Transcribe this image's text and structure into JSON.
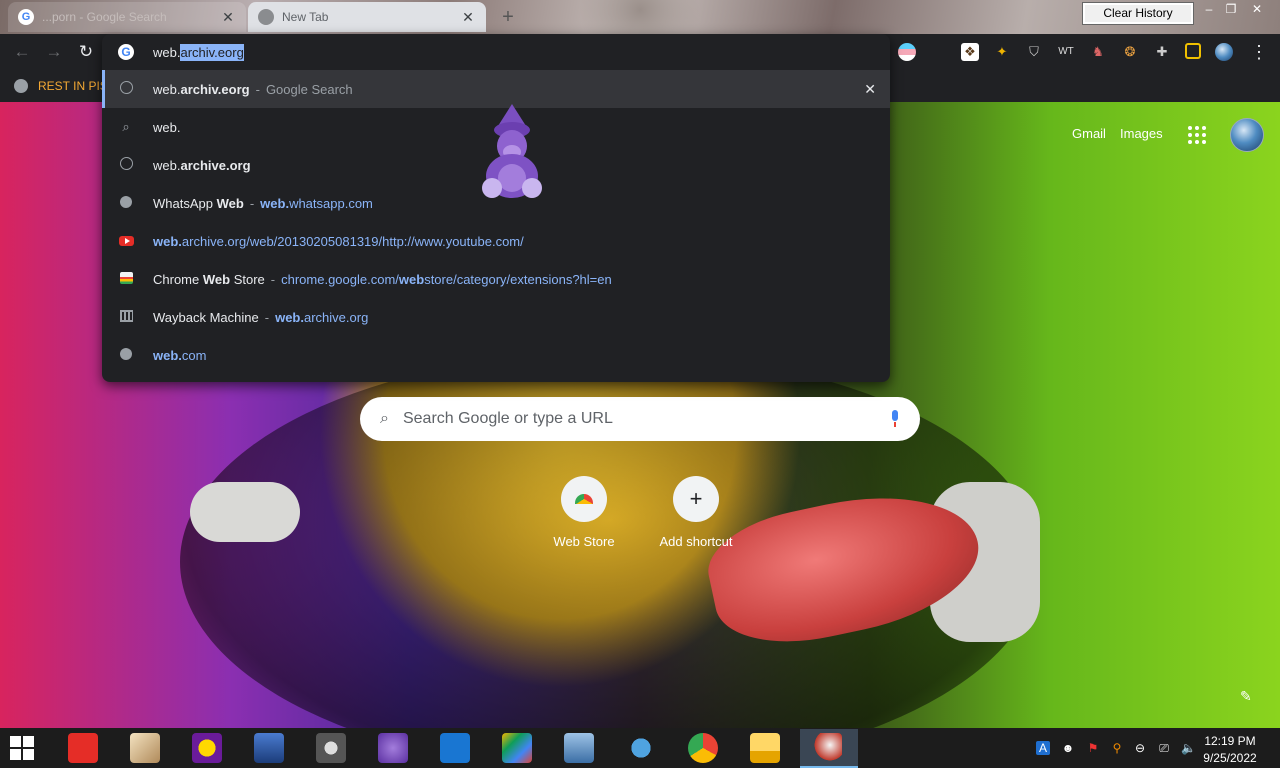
{
  "browser": {
    "tabs": [
      {
        "label": "...porn - Google Search",
        "active": false
      },
      {
        "label": "New Tab",
        "active": true
      }
    ],
    "clear_history_label": "Clear History",
    "window_controls": {
      "minimize": "–",
      "restore": "❐",
      "close": "✕"
    },
    "toolbar": {
      "back": "←",
      "forward": "→",
      "reload": "↻",
      "menu": "⋮"
    },
    "bookmarks": [
      {
        "label": "REST IN PISS"
      }
    ],
    "accent_color": "#8ab4f8"
  },
  "omnibox": {
    "typed_prefix": "web.",
    "autocomplete_selected": "archiv.eorg",
    "suggestions": [
      {
        "icon": "history-icon",
        "parts": [
          {
            "t": "web.",
            "b": false
          },
          {
            "t": "archiv.eorg",
            "b": true
          }
        ],
        "separator": "-",
        "secondary": "Google Search",
        "secondary_style": "gray",
        "highlighted": true,
        "remove": "✕"
      },
      {
        "icon": "search-icon",
        "parts": [
          {
            "t": "web.",
            "b": false
          }
        ]
      },
      {
        "icon": "history-icon",
        "parts": [
          {
            "t": "web.",
            "b": false
          },
          {
            "t": "archive.org",
            "b": true
          }
        ]
      },
      {
        "icon": "globe-icon",
        "parts": [
          {
            "t": "WhatsApp ",
            "b": false
          },
          {
            "t": "Web",
            "b": true
          }
        ],
        "separator": "-",
        "url_parts": [
          {
            "t": "web.",
            "b": true
          },
          {
            "t": "whatsapp.com",
            "b": false
          }
        ]
      },
      {
        "icon": "youtube-icon",
        "url_parts": [
          {
            "t": "web.",
            "b": true
          },
          {
            "t": "archive.org/web/20130205081319/http://www.youtube.com/",
            "b": false
          }
        ]
      },
      {
        "icon": "chrome-web-store-icon",
        "parts": [
          {
            "t": "Chrome ",
            "b": false
          },
          {
            "t": "Web",
            "b": true
          },
          {
            "t": " Store",
            "b": false
          }
        ],
        "separator": "-",
        "url_parts": [
          {
            "t": "chrome.google.com/",
            "b": false
          },
          {
            "t": "web",
            "b": true
          },
          {
            "t": "store/category/extensions?hl=en",
            "b": false
          }
        ]
      },
      {
        "icon": "museum-icon",
        "parts": [
          {
            "t": "Wayback Machine",
            "b": false
          }
        ],
        "separator": "-",
        "url_parts": [
          {
            "t": "web.",
            "b": true
          },
          {
            "t": "archive.org",
            "b": false
          }
        ]
      },
      {
        "icon": "globe-icon",
        "url_parts": [
          {
            "t": "web.",
            "b": true
          },
          {
            "t": "com",
            "b": false
          }
        ]
      }
    ]
  },
  "ntp": {
    "top_links": {
      "gmail": "Gmail",
      "images": "Images"
    },
    "search_placeholder": "Search Google or type a URL",
    "shortcuts": [
      {
        "label": "Web Store",
        "icon": "chrome-web-store-icon"
      },
      {
        "label": "Add shortcut",
        "icon": "plus-icon",
        "glyph": "+"
      }
    ],
    "customize_glyph": "✎"
  },
  "taskbar": {
    "apps": [
      "youtube-icon",
      "mail-app-icon",
      "yahoo-messenger-icon",
      "drive-icon",
      "film-reel-icon",
      "bonzi-buddy-icon",
      "arc-app-icon",
      "bluestacks-icon",
      "network-computer-icon",
      "gears-icon",
      "chrome-icon",
      "file-explorer-icon",
      "rocket-icon"
    ],
    "clock": {
      "time": "12:19 PM",
      "date": "9/25/2022"
    }
  }
}
